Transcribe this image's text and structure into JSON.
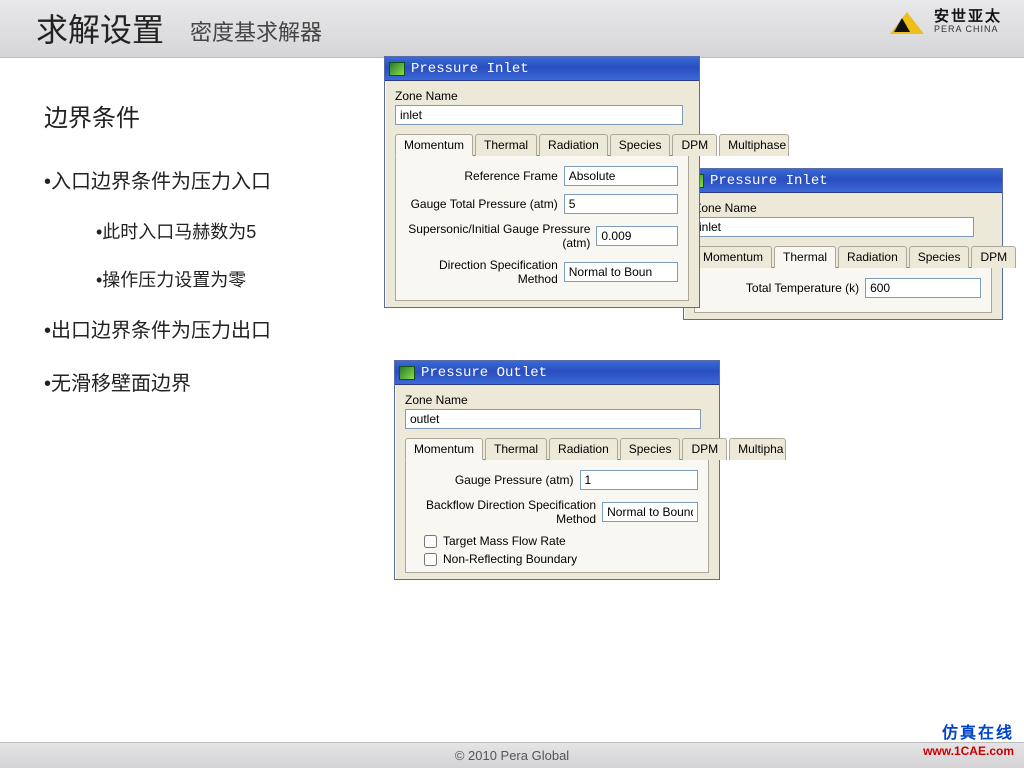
{
  "header": {
    "title": "求解设置",
    "subtitle": "密度基求解器",
    "logo_cn": "安世亚太",
    "logo_en": "PERA CHINA"
  },
  "bullets": {
    "heading": "边界条件",
    "b1": "•入口边界条件为压力入口",
    "b1a": "•此时入口马赫数为5",
    "b1b": "•操作压力设置为零",
    "b2": "•出口边界条件为压力出口",
    "b3": "•无滑移壁面边界"
  },
  "dlg_inlet1": {
    "title": "Pressure Inlet",
    "zone_label": "Zone Name",
    "zone_value": "inlet",
    "tabs": [
      "Momentum",
      "Thermal",
      "Radiation",
      "Species",
      "DPM",
      "Multiphase"
    ],
    "rows": {
      "ref_frame_label": "Reference Frame",
      "ref_frame_value": "Absolute",
      "gauge_total_label": "Gauge Total Pressure (atm)",
      "gauge_total_value": "5",
      "supersonic_label": "Supersonic/Initial Gauge Pressure (atm)",
      "supersonic_value": "0.009",
      "dir_label": "Direction Specification Method",
      "dir_value": "Normal to Boun"
    }
  },
  "dlg_inlet2": {
    "title": "Pressure Inlet",
    "zone_label": "Zone Name",
    "zone_value": "inlet",
    "tabs": [
      "Momentum",
      "Thermal",
      "Radiation",
      "Species",
      "DPM"
    ],
    "rows": {
      "temp_label": "Total Temperature (k)",
      "temp_value": "600"
    }
  },
  "dlg_outlet": {
    "title": "Pressure Outlet",
    "zone_label": "Zone Name",
    "zone_value": "outlet",
    "tabs": [
      "Momentum",
      "Thermal",
      "Radiation",
      "Species",
      "DPM",
      "Multipha"
    ],
    "rows": {
      "gauge_label": "Gauge Pressure (atm)",
      "gauge_value": "1",
      "backflow_label": "Backflow Direction Specification Method",
      "backflow_value": "Normal to Boundary"
    },
    "cb1": "Target Mass Flow Rate",
    "cb2": "Non-Reflecting Boundary"
  },
  "footer": "© 2010 Pera Global",
  "watermark_mid": "1CAE.COM",
  "watermark_cn": "仿真在线",
  "watermark_url": "www.1CAE.com"
}
